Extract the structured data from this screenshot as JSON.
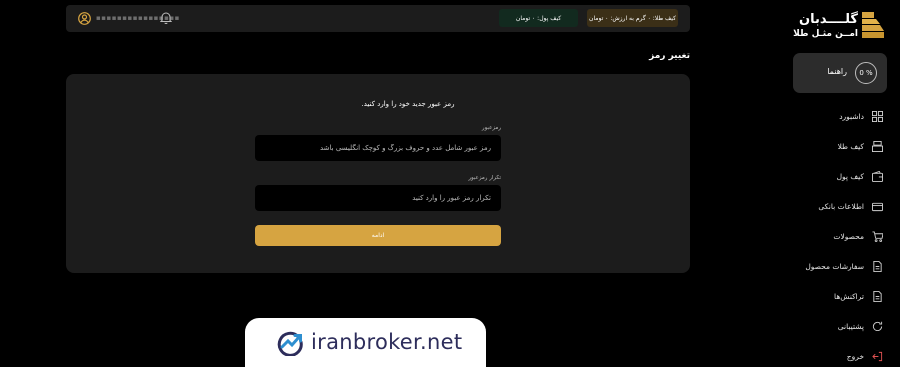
{
  "brand": {
    "name": "گلــــدبان",
    "tagline": "امــن مثـل طلا",
    "accent_color": "#d6a441"
  },
  "sidebar": {
    "guide": {
      "label": "راهنما",
      "progress_text": "0 %",
      "progress_value": 0
    },
    "items": [
      {
        "label": "داشبورد",
        "icon": "dashboard-icon"
      },
      {
        "label": "کیف طلا",
        "icon": "gold-wallet-icon"
      },
      {
        "label": "کیف پول",
        "icon": "wallet-icon"
      },
      {
        "label": "اطلاعات بانکی",
        "icon": "bank-card-icon"
      },
      {
        "label": "محصولات",
        "icon": "cart-icon"
      },
      {
        "label": "سفارشات محصول",
        "icon": "document-icon"
      },
      {
        "label": "تراکنش‌ها",
        "icon": "document-icon"
      },
      {
        "label": "پشتیبانی",
        "icon": "support-icon"
      },
      {
        "label": "خروج",
        "icon": "logout-icon"
      }
    ]
  },
  "header": {
    "user_name": "▪▪▪▪▪▪▪▪▪▪▪▪▪▪▪▪",
    "money_wallet": "کیف پول: ۰ تومان",
    "gold_wallet": "کیف طلا: ۰ گرم   به ارزش: ۰ تومان"
  },
  "page": {
    "title": "تغییر رمز",
    "intro": "رمز عبور جدید خود را وارد کنید.",
    "password_label": "رمزعبور",
    "password_placeholder": "رمز عبور شامل عدد و حروف بزرگ و کوچک انگلیسی باشد",
    "confirm_label": "تکرار رمزعبور",
    "confirm_placeholder": "تکرار رمز عبور را وارد کنید",
    "submit_label": "ادامه"
  },
  "watermark": {
    "text": "iranbroker.net"
  }
}
